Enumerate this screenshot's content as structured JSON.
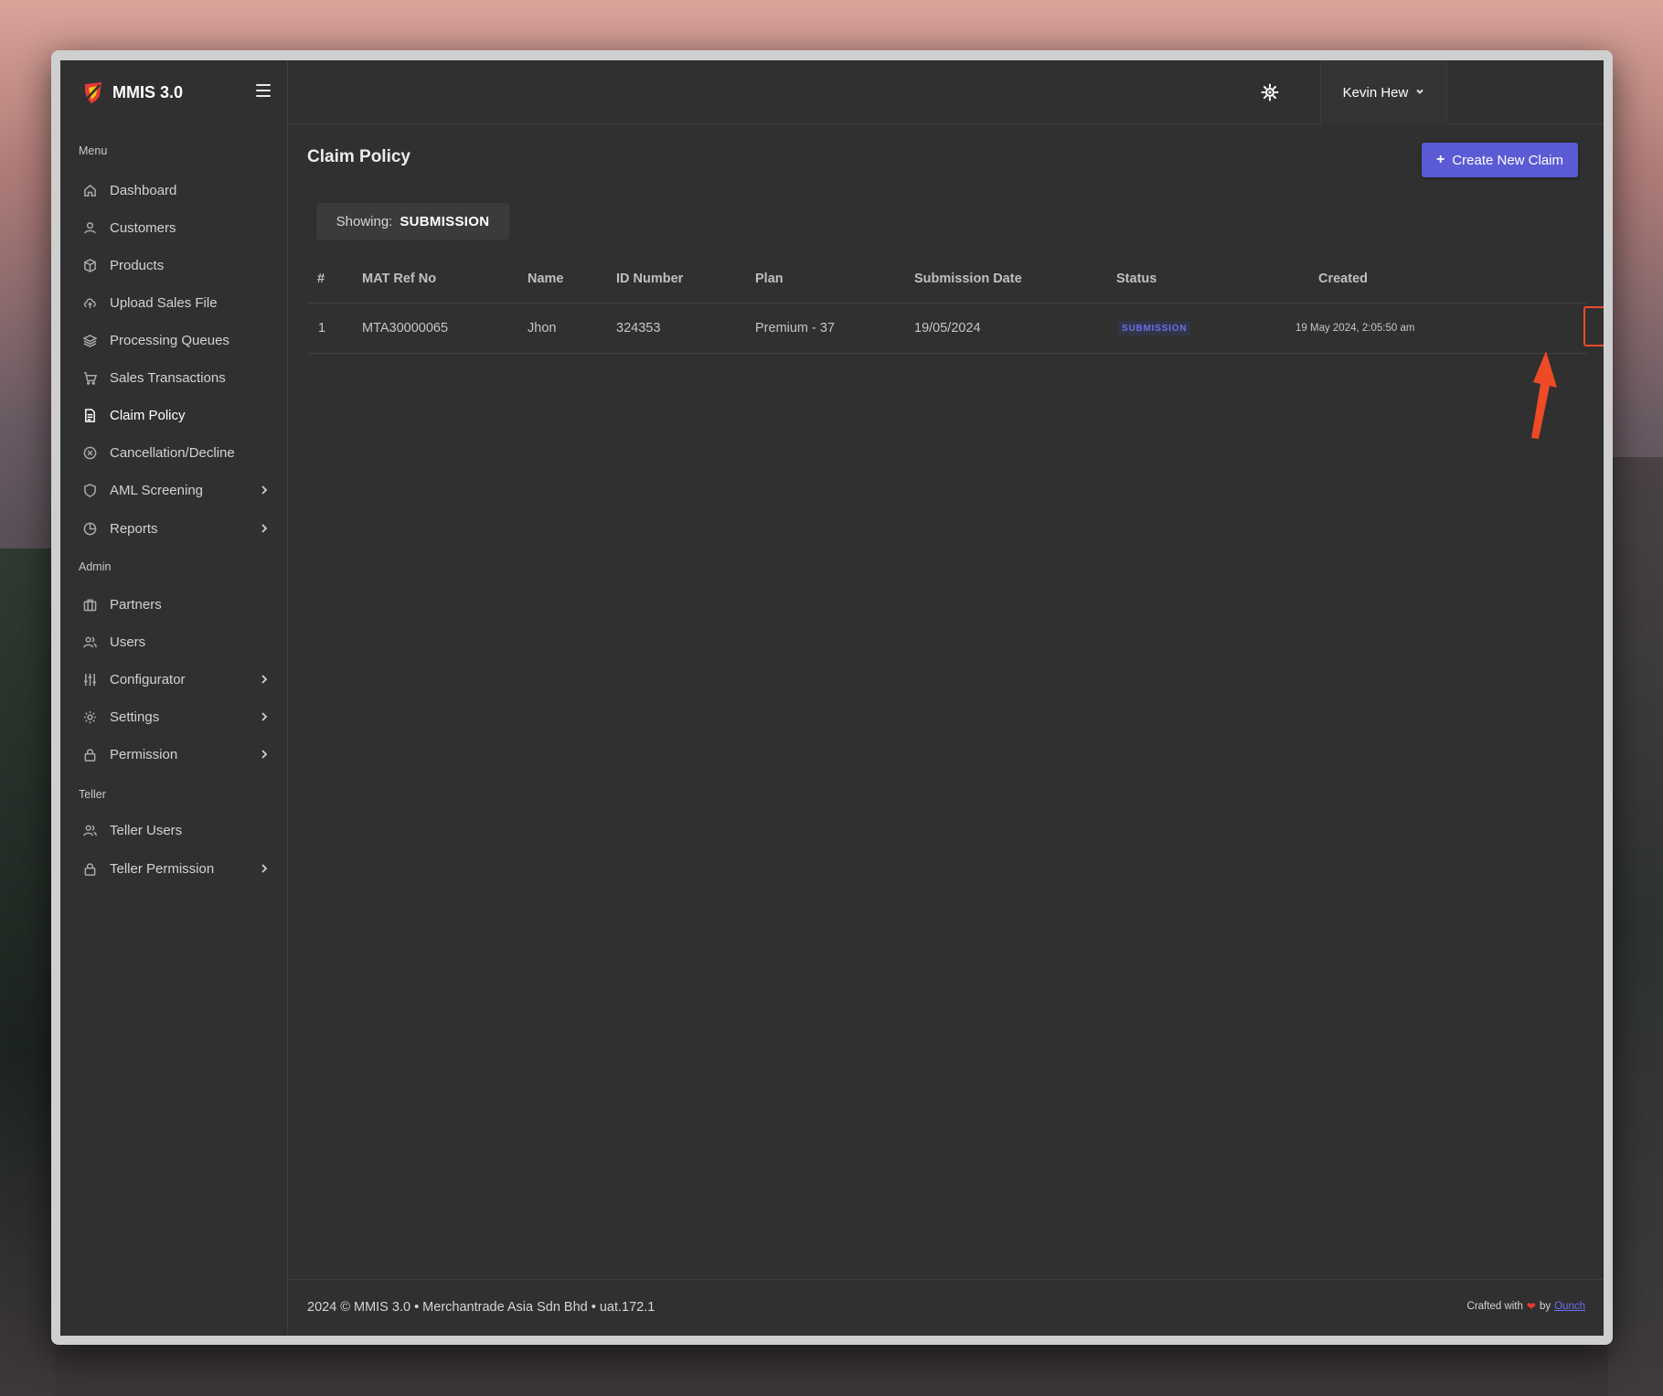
{
  "app": {
    "brand": "MMIS 3.0"
  },
  "sidebar": {
    "sections": {
      "menu": "Menu",
      "admin": "Admin",
      "teller": "Teller"
    },
    "items": [
      {
        "label": "Dashboard",
        "icon": "home-icon"
      },
      {
        "label": "Customers",
        "icon": "user-icon"
      },
      {
        "label": "Products",
        "icon": "box-icon"
      },
      {
        "label": "Upload Sales File",
        "icon": "cloud-upload-icon"
      },
      {
        "label": "Processing Queues",
        "icon": "layers-icon"
      },
      {
        "label": "Sales Transactions",
        "icon": "cart-icon"
      },
      {
        "label": "Claim Policy",
        "icon": "document-icon",
        "active": true
      },
      {
        "label": "Cancellation/Decline",
        "icon": "x-circle-icon"
      },
      {
        "label": "AML Screening",
        "icon": "shield-icon",
        "has_submenu": true
      },
      {
        "label": "Reports",
        "icon": "pie-chart-icon",
        "has_submenu": true
      },
      {
        "label": "Partners",
        "icon": "briefcase-icon"
      },
      {
        "label": "Users",
        "icon": "users-icon"
      },
      {
        "label": "Configurator",
        "icon": "sliders-icon",
        "has_submenu": true
      },
      {
        "label": "Settings",
        "icon": "gear-icon",
        "has_submenu": true
      },
      {
        "label": "Permission",
        "icon": "lock-icon",
        "has_submenu": true
      },
      {
        "label": "Teller Users",
        "icon": "users-icon"
      },
      {
        "label": "Teller Permission",
        "icon": "lock-icon",
        "has_submenu": true
      }
    ]
  },
  "header": {
    "user_name": "Kevin Hew"
  },
  "page": {
    "title": "Claim Policy",
    "create_button": "Create New Claim",
    "filter_label": "Showing:",
    "filter_value": "SUBMISSION"
  },
  "table": {
    "columns": [
      "#",
      "MAT Ref No",
      "Name",
      "ID Number",
      "Plan",
      "Submission Date",
      "Status",
      "Created"
    ],
    "rows": [
      {
        "index": "1",
        "mat_ref_no": "MTA30000065",
        "name": "Jhon",
        "id_number": "324353",
        "plan": "Premium - 37",
        "submission_date": "19/05/2024",
        "status": "SUBMISSION",
        "created": "19 May 2024, 2:05:50 am"
      }
    ]
  },
  "footer": {
    "copyright": "2024 © MMIS 3.0 • Merchantrade Asia Sdn Bhd • uat.172.1",
    "crafted_prefix": "Crafted with",
    "crafted_by": "by",
    "crafted_link": "Ounch"
  },
  "colors": {
    "accent": "#5b5bd6",
    "highlight": "#ee4a2a",
    "background": "#2f302f"
  }
}
